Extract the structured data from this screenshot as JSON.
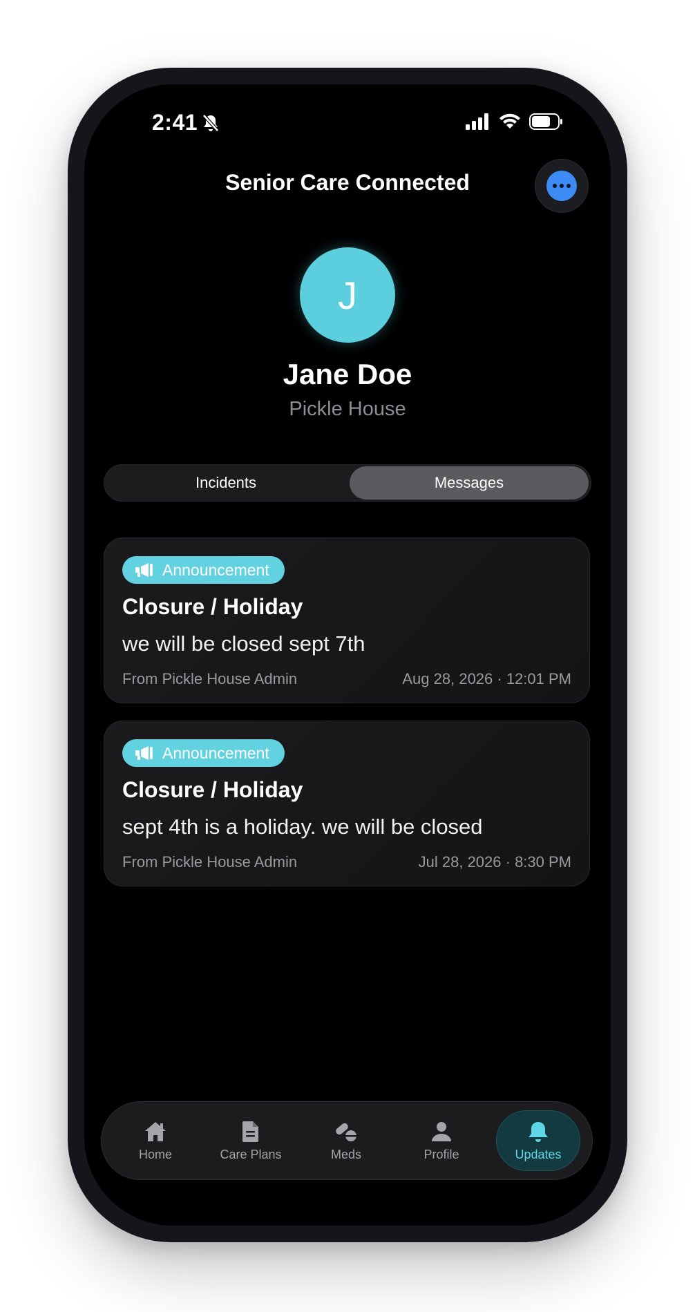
{
  "status_bar": {
    "time": "2:41",
    "icons": [
      "bell-slash-icon",
      "cellular-signal-icon",
      "wifi-icon",
      "battery-icon"
    ]
  },
  "header": {
    "title": "Senior Care Connected",
    "more_icon": "ellipsis-icon",
    "accent": "#3d8cf5"
  },
  "profile": {
    "initial": "J",
    "name": "Jane Doe",
    "location": "Pickle House",
    "avatar_color": "#5ccfdf"
  },
  "segments": {
    "items": [
      {
        "label": "Incidents",
        "selected": false
      },
      {
        "label": "Messages",
        "selected": true
      }
    ]
  },
  "messages": [
    {
      "badge": "Announcement",
      "badge_icon": "megaphone-icon",
      "title": "Closure / Holiday",
      "body": "we will be closed sept 7th",
      "from": "From Pickle House Admin",
      "date": "Aug 28, 2026 · 12:01 PM"
    },
    {
      "badge": "Announcement",
      "badge_icon": "megaphone-icon",
      "title": "Closure / Holiday",
      "body": "sept 4th is a holiday. we will be closed",
      "from": "From Pickle House Admin",
      "date": "Jul 28, 2026 · 8:30 PM"
    }
  ],
  "tabbar": {
    "items": [
      {
        "label": "Home",
        "icon": "house-icon"
      },
      {
        "label": "Care Plans",
        "icon": "document-icon"
      },
      {
        "label": "Meds",
        "icon": "pills-icon"
      },
      {
        "label": "Profile",
        "icon": "person-icon"
      },
      {
        "label": "Updates",
        "icon": "bell-icon",
        "active": true
      }
    ],
    "active_color": "#5ed7e6"
  }
}
